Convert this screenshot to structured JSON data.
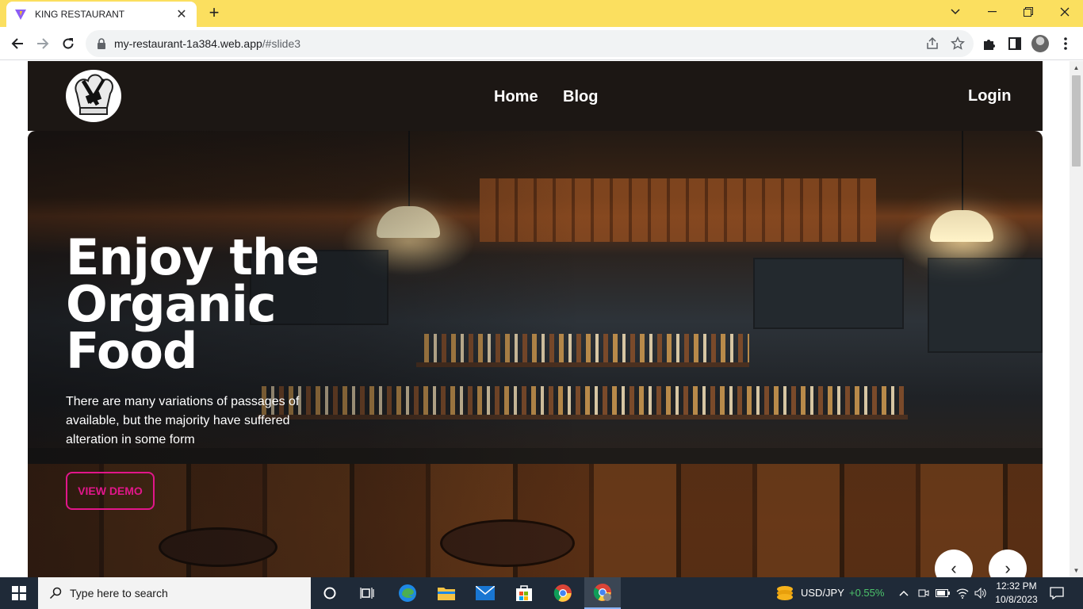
{
  "browser": {
    "tab_title": "KING RESTAURANT",
    "url_host": "my-restaurant-1a384.web.app",
    "url_path": "/#slide3"
  },
  "site": {
    "nav": {
      "home": "Home",
      "blog": "Blog",
      "login": "Login"
    },
    "hero": {
      "title_line1": "Enjoy the",
      "title_line2": "Organic",
      "title_line3": "Food",
      "description": "There are many variations of passages of available, but the majority have suffered alteration in some form",
      "button": "VIEW DEMO",
      "prev": "‹",
      "next": "›"
    }
  },
  "taskbar": {
    "search_placeholder": "Type here to search",
    "ticker_symbol": "USD/JPY",
    "ticker_change": "+0.55%",
    "time": "12:32 PM",
    "date": "10/8/2023"
  },
  "colors": {
    "titlebar": "#fbdf5f",
    "accent_button": "#e2168a",
    "ticker_positive": "#4cc36b"
  }
}
